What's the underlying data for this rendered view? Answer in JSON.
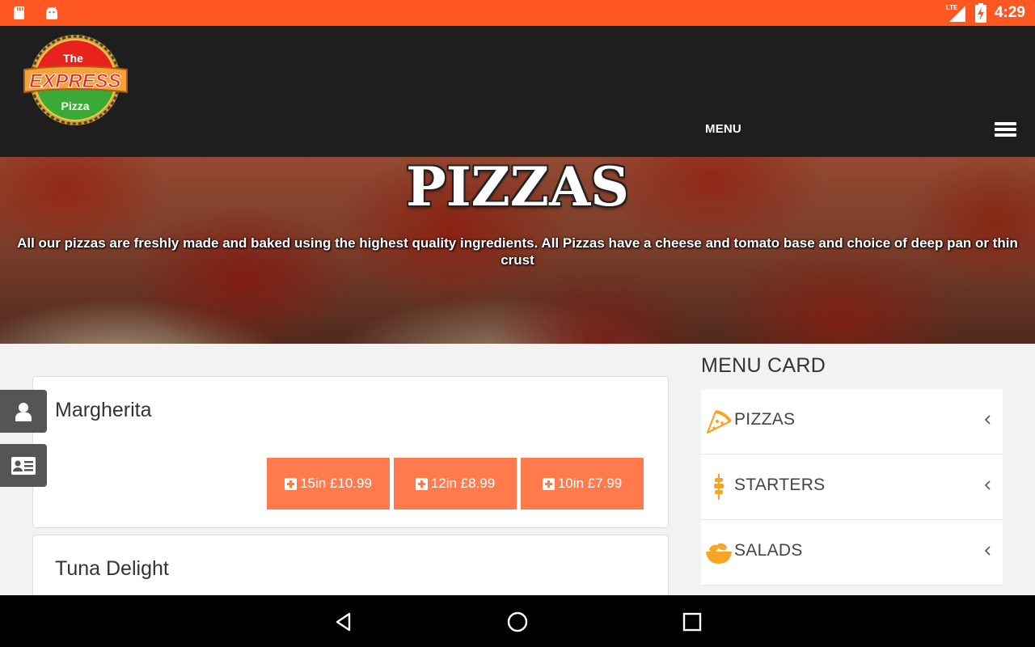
{
  "status_bar": {
    "time": "4:29",
    "network": "LTE",
    "color": "#ff5722",
    "icons": [
      "sd-card-icon",
      "android-icon",
      "signal-icon",
      "battery-charging-icon"
    ]
  },
  "header": {
    "logo": {
      "line1": "The",
      "line2": "EXPRESS",
      "line3": "Pizza"
    },
    "menu_label": "MENU"
  },
  "hero": {
    "title": "PIZZAS",
    "subtitle": "All our pizzas are freshly made and baked using the highest quality ingredients. All Pizzas have a cheese and tomato base and choice of deep pan or thin crust"
  },
  "side_tabs": [
    "user-icon",
    "contact-card-icon"
  ],
  "items": [
    {
      "name": "Margherita",
      "prices": [
        {
          "label": "15in £10.99"
        },
        {
          "label": "12in £8.99"
        },
        {
          "label": "10in £7.99"
        }
      ]
    },
    {
      "name": "Tuna Delight",
      "prices": []
    }
  ],
  "menu_card": {
    "title": "MENU CARD",
    "categories": [
      {
        "label": "PIZZAS",
        "icon": "pizza-slice-icon"
      },
      {
        "label": "STARTERS",
        "icon": "skewer-icon"
      },
      {
        "label": "SALADS",
        "icon": "salad-bowl-icon"
      }
    ]
  },
  "colors": {
    "accent": "#ff7a4d",
    "icon_orange": "#f5a623",
    "header_bg": "#1e1e1e"
  }
}
